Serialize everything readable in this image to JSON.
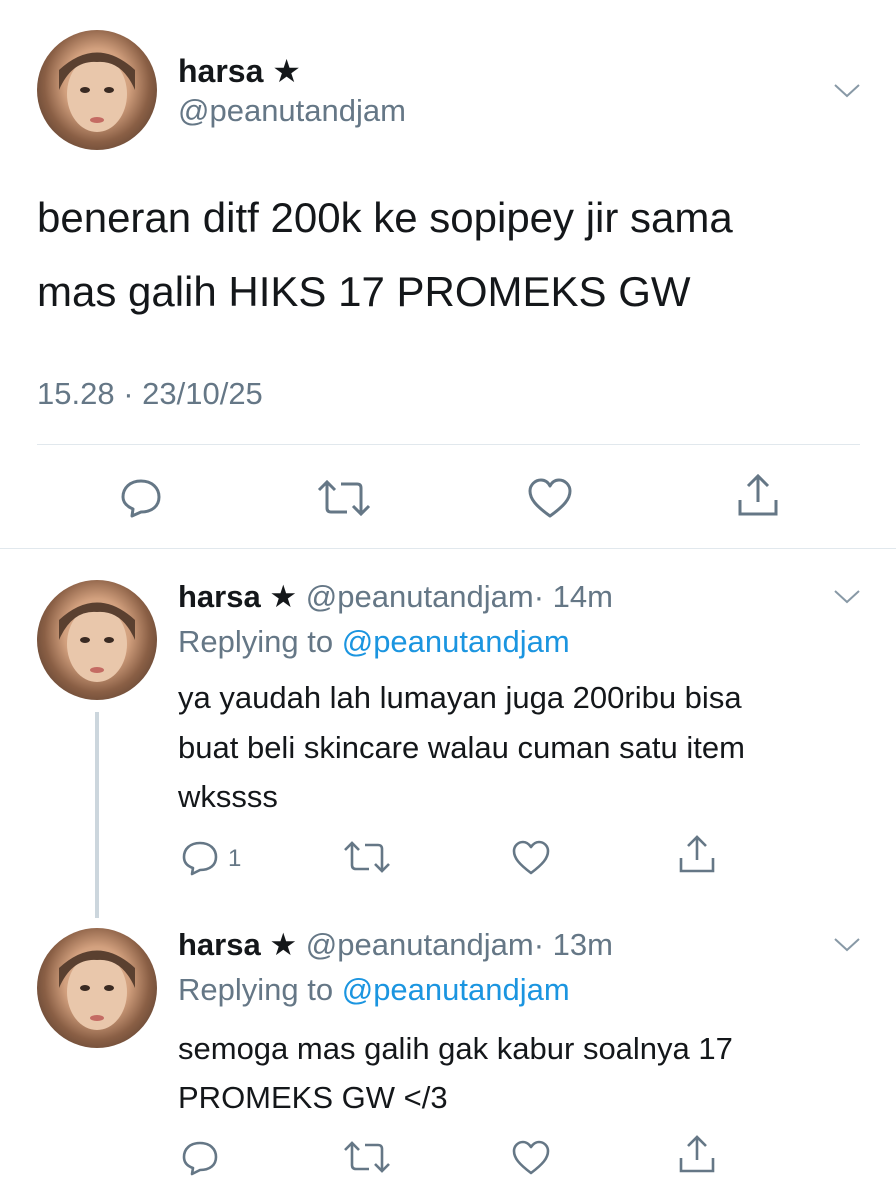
{
  "main_tweet": {
    "name": "harsa",
    "star": "★",
    "handle": "@peanutandjam",
    "text_line1": "beneran ditf 200k ke sopipey jir sama",
    "text_line2": "mas galih HIKS 17 PROMEKS GW",
    "timestamp": "15.28 · 23/10/25"
  },
  "replies": [
    {
      "name": "harsa",
      "star": "★",
      "handle": "@peanutandjam",
      "time": "· 14m",
      "replying_prefix": "Replying to",
      "replying_handle": "@peanutandjam",
      "text_line1": "ya yaudah lah lumayan juga 200ribu bisa",
      "text_line2": "buat beli skincare walau cuman satu item",
      "text_line3": "wkssss",
      "reply_count": "1"
    },
    {
      "name": "harsa",
      "star": "★",
      "handle": "@peanutandjam",
      "time": "· 13m",
      "replying_prefix": "Replying to",
      "replying_handle": "@peanutandjam",
      "text_line1": "semoga mas galih gak kabur soalnya 17",
      "text_line2": "PROMEKS GW </3",
      "reply_count": ""
    }
  ],
  "icons": [
    "reply-icon",
    "retweet-icon",
    "like-icon",
    "share-icon",
    "chevron-down-icon"
  ],
  "colors": {
    "text": "#14171a",
    "secondary": "#657786",
    "link": "#1b95e0",
    "divider": "#e1e8ed",
    "thread_line": "#ccd6dd"
  }
}
